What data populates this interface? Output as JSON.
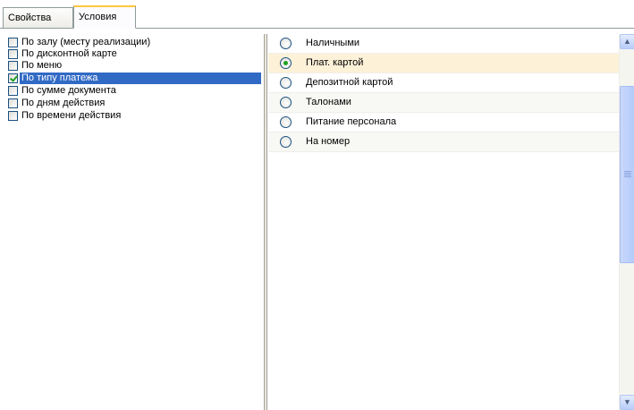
{
  "tabs": [
    {
      "label": "Свойства"
    },
    {
      "label": "Условия"
    }
  ],
  "conditions": [
    {
      "label": "По залу (месту реализации)",
      "checked": false
    },
    {
      "label": "По дисконтной карте",
      "checked": false
    },
    {
      "label": "По меню",
      "checked": false
    },
    {
      "label": "По типу платежа",
      "checked": true
    },
    {
      "label": "По сумме документа",
      "checked": false
    },
    {
      "label": "По дням действия",
      "checked": false
    },
    {
      "label": "По времени действия",
      "checked": false
    }
  ],
  "payment_types": [
    {
      "label": "Наличными",
      "selected": false
    },
    {
      "label": "Плат. картой",
      "selected": true
    },
    {
      "label": "Депозитной картой",
      "selected": false
    },
    {
      "label": "Талонами",
      "selected": false
    },
    {
      "label": "Питание персонала",
      "selected": false
    },
    {
      "label": "На номер",
      "selected": false
    }
  ],
  "icons": {
    "scroll_up": "chevron-up-icon",
    "scroll_down": "chevron-down-icon"
  },
  "colors": {
    "selection": "#316ac5",
    "radio_row_selected": "#fdf1d8",
    "check_green": "#21a121",
    "active_tab_accent": "#ffc83c"
  }
}
